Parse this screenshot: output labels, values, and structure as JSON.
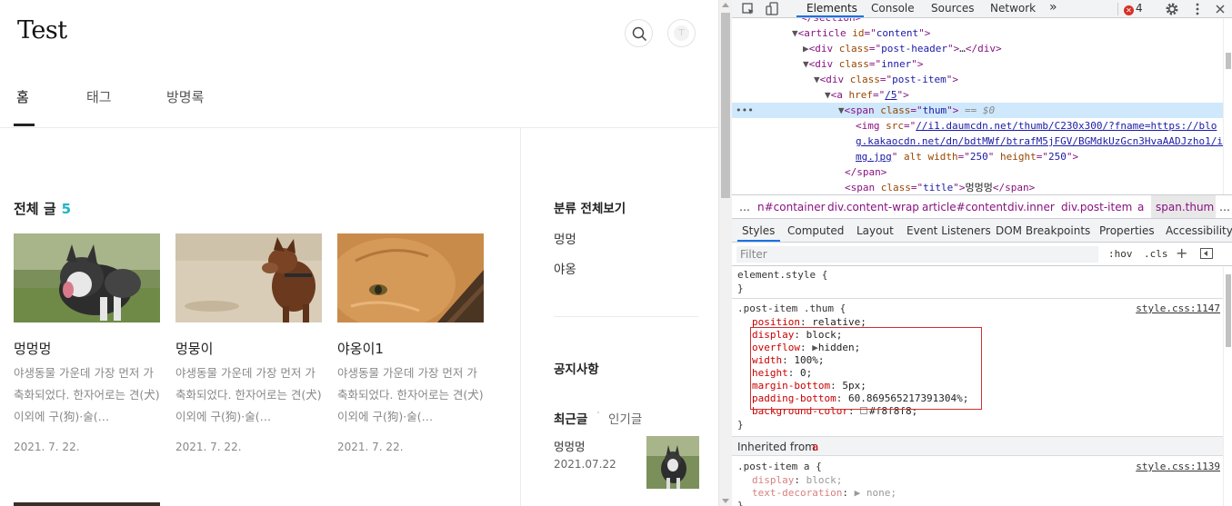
{
  "blog": {
    "site_title": "Test",
    "nav": [
      "홈",
      "태그",
      "방명록"
    ],
    "list_heading": "전체 글",
    "post_count": "5",
    "posts": [
      {
        "title": "멍멍멍",
        "summary": "야생동물 가운데 가장 먼저 가축화되었다. 한자어로는 견(犬) 이외에 구(狗)·술(…",
        "date": "2021. 7. 22."
      },
      {
        "title": "멍뭉이",
        "summary": "야생동물 가운데 가장 먼저 가축화되었다. 한자어로는 견(犬) 이외에 구(狗)·술(…",
        "date": "2021. 7. 22."
      },
      {
        "title": "야옹이1",
        "summary": "야생동물 가운데 가장 먼저 가축화되었다. 한자어로는 견(犬) 이외에 구(狗)·술(…",
        "date": "2021. 7. 22."
      }
    ],
    "sidebar": {
      "category_heading": "분류 전체보기",
      "categories": [
        "멍멍",
        "야옹"
      ],
      "notice_heading": "공지사항",
      "recent_tab": "최근글",
      "popular_tab": "인기글",
      "recent_post": {
        "title": "멍멍멍",
        "date": "2021.07.22"
      }
    }
  },
  "devtools": {
    "tabs": [
      "Elements",
      "Console",
      "Sources",
      "Network"
    ],
    "more": "»",
    "error_count": "4",
    "dom": {
      "article_id": "content",
      "post_header_class": "post-header",
      "inner_class": "inner",
      "post_item_class": "post-item",
      "href": "/5",
      "thum_class": "thum",
      "eq_marker": "== $0",
      "img_src_1": "//i1.daumcdn.net/thumb/C230x300/?fname=https://blo",
      "img_src_2": "g.kakaocdn.net/dn/bdtMWf/btrafM5jFGV/BGMdkUzGcn3HvaAADJzho1/i",
      "img_src_3": "mg.jpg",
      "img_width": "250",
      "img_height": "250",
      "title_class": "title",
      "title_text": "멍멍멍"
    },
    "breadcrumbs": [
      "…",
      "n#container",
      "div.content-wrap",
      "article#content",
      "div.inner",
      "div.post-item",
      "a",
      "span.thum",
      "…"
    ],
    "sub_tabs": [
      "Styles",
      "Computed",
      "Layout",
      "Event Listeners",
      "DOM Breakpoints",
      "Properties",
      "Accessibility"
    ],
    "filter_placeholder": "Filter",
    "hov": ":hov",
    "cls": ".cls",
    "styles": {
      "element_style": "element.style {",
      "close": "}",
      "rule1_selector": ".post-item .thum {",
      "rule1_source": "style.css:1147",
      "rule1_props": [
        {
          "name": "position",
          "value": "relative;"
        },
        {
          "name": "display",
          "value": "block;"
        },
        {
          "name": "overflow",
          "value": "hidden;"
        },
        {
          "name": "width",
          "value": "100%;"
        },
        {
          "name": "height",
          "value": "0;"
        },
        {
          "name": "margin-bottom",
          "value": "5px;"
        },
        {
          "name": "padding-bottom",
          "value": "60.869565217391304%;"
        },
        {
          "name": "background-color",
          "value": "#f8f8f8;"
        }
      ],
      "inherited_label": "Inherited from",
      "inherited_tag": "a",
      "rule2_selector": ".post-item a {",
      "rule2_source": "style.css:1139",
      "rule2_props": [
        {
          "name": "display",
          "value": "block;"
        },
        {
          "name": "text-decoration",
          "value": "none;"
        }
      ]
    }
  },
  "colors": {
    "accent": "#1fb5c4",
    "devtools_blue": "#1a73e8",
    "highlight_red": "#d32f2f",
    "error_red": "#d93025"
  }
}
